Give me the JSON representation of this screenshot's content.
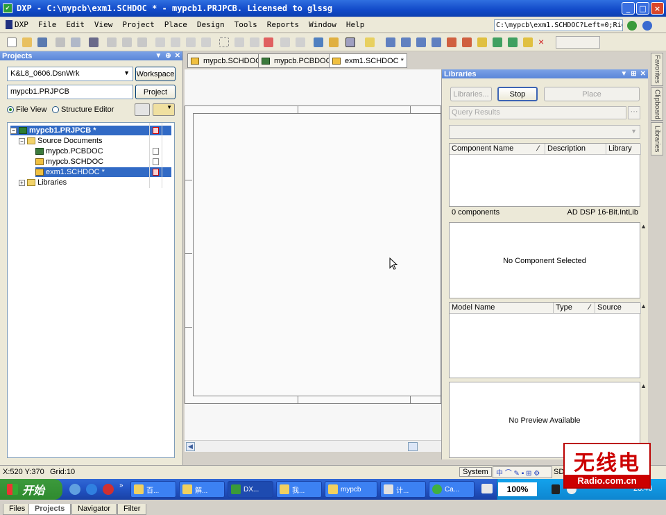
{
  "window": {
    "title": "DXP - C:\\mypcb\\exm1.SCHDOC * - mypcb1.PRJPCB. Licensed to glssg",
    "controls": {
      "minimize": "_",
      "maximize": "□",
      "close": "×"
    }
  },
  "menu": {
    "dxp": "DXP",
    "items": [
      "File",
      "Edit",
      "View",
      "Project",
      "Place",
      "Design",
      "Tools",
      "Reports",
      "Window",
      "Help"
    ],
    "path": "C:\\mypcb\\exm1.SCHDOC?Left=0;Rig"
  },
  "projects_panel": {
    "title": "Projects",
    "workspace_value": "K&L8_0606.DsnWrk",
    "workspace_button": "Workspace",
    "project_value": "mypcb1.PRJPCB",
    "project_button": "Project",
    "view_file": "File View",
    "view_structure": "Structure Editor",
    "tree": {
      "project": "mypcb1.PRJPCB *",
      "source_folder": "Source Documents",
      "docs": [
        "mypcb.PCBDOC",
        "mypcb.SCHDOC",
        "exm1.SCHDOC *"
      ],
      "libraries": "Libraries"
    },
    "bottom_tabs": [
      "Files",
      "Projects",
      "Navigator",
      "Filter"
    ]
  },
  "doc_tabs": [
    "mypcb.SCHDOC",
    "mypcb.PCBDOC",
    "exm1.SCHDOC *"
  ],
  "libraries_panel": {
    "title": "Libraries",
    "btn_libraries": "Libraries...",
    "btn_stop": "Stop",
    "btn_place": "Place",
    "query_placeholder": "Query Results",
    "columns": [
      "Component Name",
      "Description",
      "Library"
    ],
    "count": "0 components",
    "library_name": "AD DSP 16-Bit.IntLib",
    "no_component": "No Component Selected",
    "model_columns": [
      "Model Name",
      "Type",
      "Source"
    ],
    "no_preview": "No Preview Available"
  },
  "side_tabs": [
    "Favorites",
    "Clipboard",
    "Libraries"
  ],
  "status": {
    "coords": "X:520 Y:370",
    "grid": "Grid:10",
    "system": "System",
    "sd": "SD"
  },
  "taskbar": {
    "start": "开始",
    "buttons": [
      "百...",
      "解...",
      "DX...",
      "我...",
      "mypcb",
      "计...",
      "Ca..."
    ],
    "zoom": "100%",
    "clock": "23:46"
  },
  "watermark": {
    "cn": "无线电",
    "url": "Radio.com.cn"
  }
}
